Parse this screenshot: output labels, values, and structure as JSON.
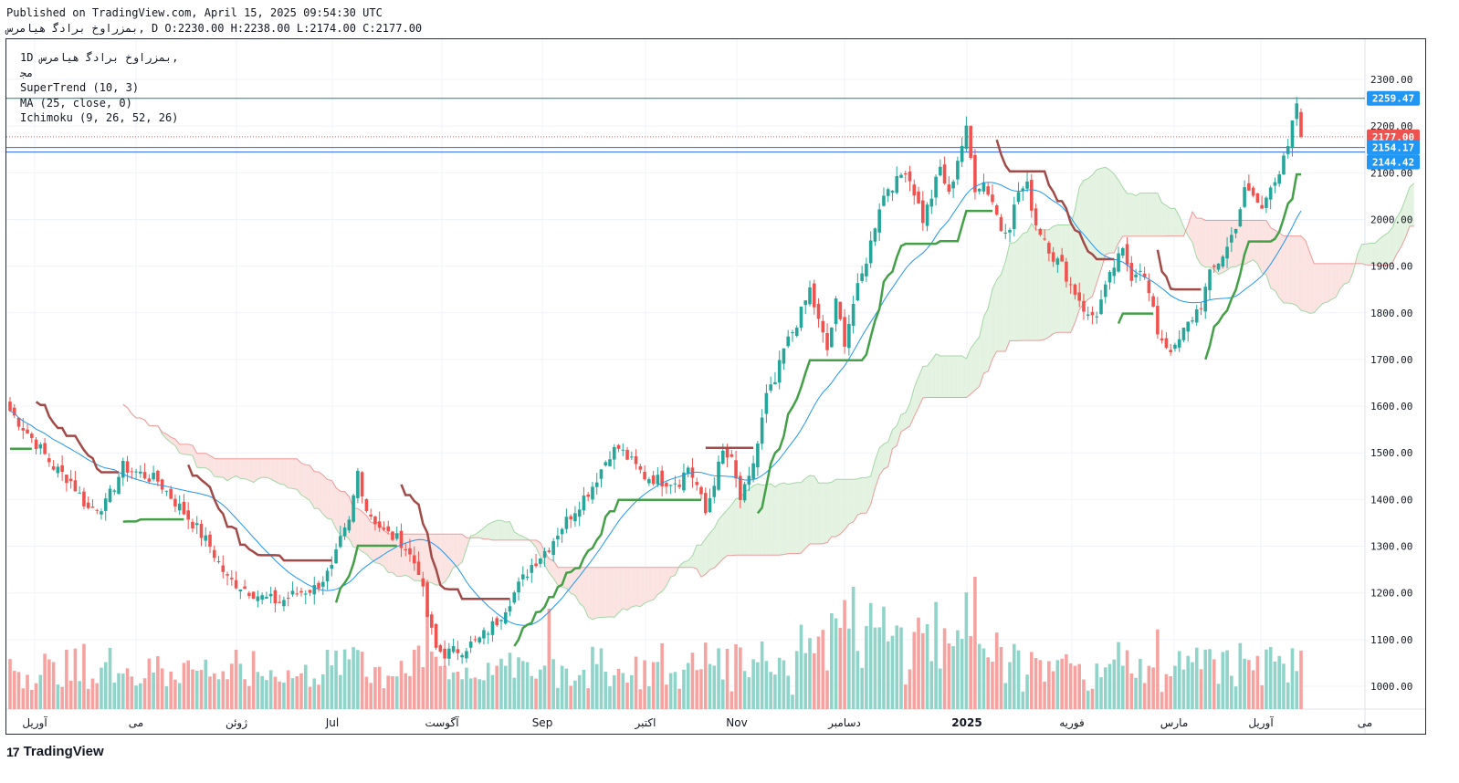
{
  "header": {
    "published_line": "Published on TradingView.com, April 15, 2025 09:54:30 UTC",
    "ohlc_line": "ﺑﻤﺰﺭﺍﻭﺥ ﺑﺮﺍﺩﮔ ﻫﻴﺎﻣﺮﺱ, D O:2230.00 H:2238.00 L:2174.00 C:2177.00"
  },
  "legend": {
    "symbol": "1D ﺑﻤﺰﺭﺍﻭﺥ ﺑﺮﺍﺩﮔ ﻫﻴﺎﻣﺮﺱ,",
    "exchange": "ﻣﺠ",
    "supertrend": "SuperTrend (10, 3)",
    "ma": "MA (25, close, 0)",
    "ichimoku": "Ichimoku (9, 26, 52, 26)"
  },
  "footer": {
    "logo_text": "TradingView",
    "logo_mark": "17"
  },
  "colors": {
    "up": "#26a69a",
    "down": "#ef5350",
    "vol_up": "#8fd3c9",
    "vol_down": "#f5a3a0",
    "supertrend_up": "#43a047",
    "supertrend_down": "#a14a48",
    "ma": "#2196f3",
    "cloud_green": "#e3f2e1",
    "cloud_red": "#fbe3e1",
    "span_a": "#a5d6a7",
    "span_b": "#ef9a9a",
    "hline_teal": "#138484",
    "hline_blue": "#2962ff"
  },
  "chart_data": {
    "type": "candlestick",
    "timeframe": "1D",
    "y_axis": {
      "ticks": [
        1000,
        1100,
        1200,
        1300,
        1400,
        1500,
        1600,
        1700,
        1800,
        1900,
        2000,
        2100,
        2200,
        2300
      ],
      "labels": [
        "1000.00",
        "1100.00",
        "1200.00",
        "1300.00",
        "1400.00",
        "1500.00",
        "1600.00",
        "1700.00",
        "1800.00",
        "1900.00",
        "2000.00",
        "2100.00",
        "2200.00",
        "2300.00"
      ],
      "range": [
        950,
        2380
      ]
    },
    "x_axis": {
      "labels": [
        "آوریل",
        "می",
        "ژوئن",
        "Jul",
        "آگوست",
        "Sep",
        "اکتبر",
        "Nov",
        "دسامبر",
        "2025",
        "فوریه",
        "مارس",
        "آوریل",
        "می"
      ],
      "bold": [
        "2025"
      ]
    },
    "price_labels": [
      {
        "value": 2259.47,
        "text": "2259.47",
        "color": "#2196f3"
      },
      {
        "value": 2177.0,
        "text": "2177.00",
        "color": "#ef5350"
      },
      {
        "value": 2154.17,
        "text": "2154.17",
        "color": "#2196f3"
      },
      {
        "value": 2144.42,
        "text": "2144.42",
        "color": "#2196f3"
      }
    ],
    "horizontal_lines": [
      {
        "value": 2259.47,
        "style": "solid",
        "color": "#138484"
      },
      {
        "value": 2177.0,
        "style": "dotted",
        "color": "#ef5350"
      },
      {
        "value": 2154.17,
        "style": "solid",
        "color": "#2962ff"
      },
      {
        "value": 2144.42,
        "style": "solid",
        "color": "#2962ff"
      }
    ],
    "last_candle": {
      "open": 2230.0,
      "high": 2238.0,
      "low": 2174.0,
      "close": 2177.0
    },
    "price_path": [
      [
        0,
        1590
      ],
      [
        6,
        1520
      ],
      [
        10,
        1470
      ],
      [
        14,
        1440
      ],
      [
        18,
        1380
      ],
      [
        22,
        1390
      ],
      [
        26,
        1470
      ],
      [
        30,
        1455
      ],
      [
        34,
        1440
      ],
      [
        38,
        1395
      ],
      [
        42,
        1350
      ],
      [
        46,
        1300
      ],
      [
        50,
        1230
      ],
      [
        54,
        1210
      ],
      [
        58,
        1190
      ],
      [
        62,
        1180
      ],
      [
        66,
        1200
      ],
      [
        70,
        1210
      ],
      [
        74,
        1250
      ],
      [
        76,
        1310
      ],
      [
        78,
        1350
      ],
      [
        80,
        1460
      ],
      [
        82,
        1380
      ],
      [
        86,
        1330
      ],
      [
        90,
        1310
      ],
      [
        92,
        1280
      ],
      [
        94,
        1250
      ],
      [
        96,
        1150
      ],
      [
        98,
        1080
      ],
      [
        100,
        1070
      ],
      [
        104,
        1080
      ],
      [
        108,
        1100
      ],
      [
        112,
        1140
      ],
      [
        116,
        1200
      ],
      [
        120,
        1260
      ],
      [
        124,
        1300
      ],
      [
        126,
        1330
      ],
      [
        130,
        1380
      ],
      [
        134,
        1430
      ],
      [
        138,
        1500
      ],
      [
        140,
        1510
      ],
      [
        142,
        1490
      ],
      [
        146,
        1450
      ],
      [
        150,
        1440
      ],
      [
        154,
        1440
      ],
      [
        156,
        1470
      ],
      [
        158,
        1430
      ],
      [
        160,
        1370
      ],
      [
        162,
        1440
      ],
      [
        164,
        1500
      ],
      [
        166,
        1480
      ],
      [
        168,
        1400
      ],
      [
        170,
        1440
      ],
      [
        172,
        1520
      ],
      [
        174,
        1620
      ],
      [
        176,
        1650
      ],
      [
        178,
        1720
      ],
      [
        180,
        1760
      ],
      [
        182,
        1800
      ],
      [
        184,
        1850
      ],
      [
        186,
        1780
      ],
      [
        188,
        1720
      ],
      [
        190,
        1820
      ],
      [
        192,
        1740
      ],
      [
        194,
        1820
      ],
      [
        196,
        1880
      ],
      [
        198,
        1950
      ],
      [
        200,
        2030
      ],
      [
        202,
        2070
      ],
      [
        204,
        2080
      ],
      [
        206,
        2110
      ],
      [
        208,
        2060
      ],
      [
        210,
        2000
      ],
      [
        212,
        2050
      ],
      [
        214,
        2110
      ],
      [
        216,
        2050
      ],
      [
        218,
        2130
      ],
      [
        220,
        2190
      ],
      [
        222,
        2070
      ],
      [
        224,
        2080
      ],
      [
        226,
        2040
      ],
      [
        228,
        1980
      ],
      [
        230,
        1990
      ],
      [
        232,
        2060
      ],
      [
        234,
        2070
      ],
      [
        236,
        1990
      ],
      [
        238,
        1960
      ],
      [
        240,
        1920
      ],
      [
        242,
        1900
      ],
      [
        244,
        1860
      ],
      [
        246,
        1830
      ],
      [
        248,
        1790
      ],
      [
        250,
        1800
      ],
      [
        252,
        1850
      ],
      [
        254,
        1900
      ],
      [
        256,
        1930
      ],
      [
        258,
        1880
      ],
      [
        260,
        1900
      ],
      [
        262,
        1840
      ],
      [
        264,
        1760
      ],
      [
        266,
        1730
      ],
      [
        268,
        1720
      ],
      [
        270,
        1760
      ],
      [
        272,
        1790
      ],
      [
        274,
        1820
      ],
      [
        276,
        1880
      ],
      [
        278,
        1910
      ],
      [
        280,
        1940
      ],
      [
        282,
        1990
      ],
      [
        284,
        2060
      ],
      [
        286,
        2050
      ],
      [
        288,
        2020
      ],
      [
        290,
        2080
      ],
      [
        292,
        2100
      ],
      [
        294,
        2150
      ],
      [
        296,
        2250
      ],
      [
        297,
        2177
      ]
    ],
    "ma25": "moving average of close, 25 periods",
    "supertrend": {
      "period": 10,
      "multiplier": 3
    },
    "ichimoku": {
      "conversion": 9,
      "base": 26,
      "span_b": 52,
      "displacement": 26
    }
  }
}
